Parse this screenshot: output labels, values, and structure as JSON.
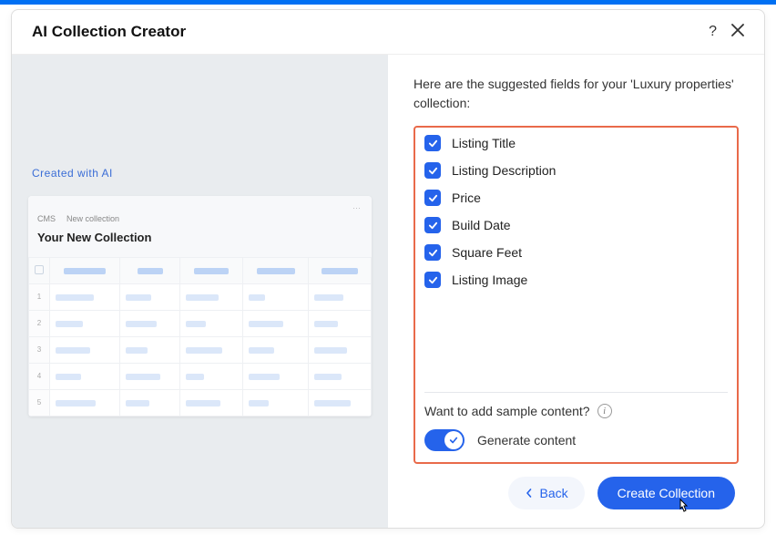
{
  "modal": {
    "title": "AI Collection Creator"
  },
  "preview": {
    "badge": "Created with AI",
    "breadcrumb1": "CMS",
    "breadcrumb2": "New collection",
    "title": "Your New Collection"
  },
  "intro": "Here are the suggested fields for your 'Luxury properties' collection:",
  "fields": [
    {
      "label": "Listing Title"
    },
    {
      "label": "Listing Description"
    },
    {
      "label": "Price"
    },
    {
      "label": "Build Date"
    },
    {
      "label": "Square Feet"
    },
    {
      "label": "Listing Image"
    }
  ],
  "sample": {
    "prompt": "Want to add sample content?",
    "toggle_label": "Generate content"
  },
  "buttons": {
    "back": "Back",
    "create": "Create Collection"
  }
}
